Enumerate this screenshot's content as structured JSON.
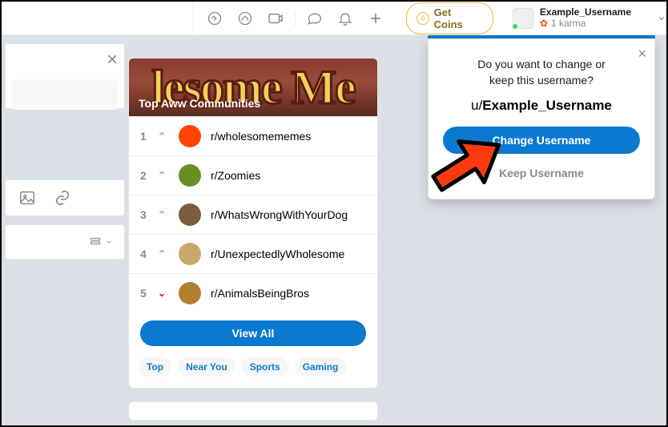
{
  "header": {
    "get_coins_label": "Get Coins",
    "user": {
      "name": "Example_Username",
      "karma": "1 karma"
    }
  },
  "communities_card": {
    "banner_decor_text": "lesome Me",
    "banner_title": "Top Aww Communities",
    "items": [
      {
        "rank": "1",
        "trend": "up",
        "name": "r/wholesomememes",
        "avatar_color": "#ff4500"
      },
      {
        "rank": "2",
        "trend": "up",
        "name": "r/Zoomies",
        "avatar_color": "#6b8e23"
      },
      {
        "rank": "3",
        "trend": "up",
        "name": "r/WhatsWrongWithYourDog",
        "avatar_color": "#7a5c3e"
      },
      {
        "rank": "4",
        "trend": "up",
        "name": "r/UnexpectedlyWholesome",
        "avatar_color": "#c8a96a"
      },
      {
        "rank": "5",
        "trend": "down",
        "name": "r/AnimalsBeingBros",
        "avatar_color": "#b08030"
      }
    ],
    "view_all_label": "View All",
    "chips": [
      "Top",
      "Near You",
      "Sports",
      "Gaming"
    ]
  },
  "username_popup": {
    "question_line1": "Do you want to change or",
    "question_line2": "keep this username?",
    "prefix": "u/",
    "username": "Example_Username",
    "change_label": "Change Username",
    "keep_label": "Keep Username"
  }
}
